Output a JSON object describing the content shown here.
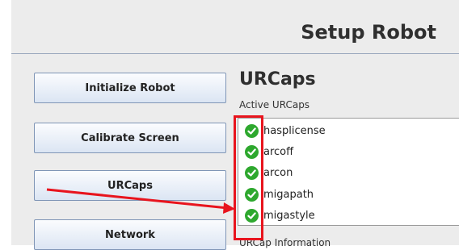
{
  "header": {
    "title": "Setup Robot"
  },
  "nav": {
    "buttons": [
      {
        "label": "Initialize Robot"
      },
      {
        "label": "Calibrate Screen"
      },
      {
        "label": "URCaps"
      },
      {
        "label": "Network"
      }
    ]
  },
  "main": {
    "title": "URCaps",
    "active_label": "Active URCaps",
    "urcaps": [
      {
        "name": "hasplicense"
      },
      {
        "name": "arcoff"
      },
      {
        "name": "arcon"
      },
      {
        "name": "migapath"
      },
      {
        "name": "migastyle"
      }
    ],
    "info_label": "URCap Information"
  },
  "colors": {
    "annotation": "#e8141d",
    "check": "#2ea82e",
    "button_border": "#7f95b6"
  }
}
